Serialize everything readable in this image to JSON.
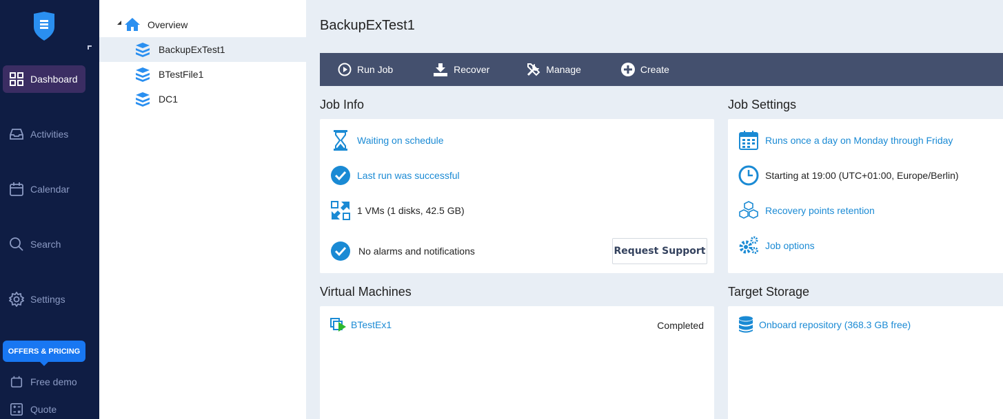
{
  "sidebar": {
    "items": [
      {
        "label": "Dashboard",
        "icon": "grid-icon"
      },
      {
        "label": "Activities",
        "icon": "inbox-icon"
      },
      {
        "label": "Calendar",
        "icon": "calendar-icon"
      },
      {
        "label": "Search",
        "icon": "search-icon"
      },
      {
        "label": "Settings",
        "icon": "gear-icon"
      }
    ],
    "offers_label": "OFFERS & PRICING",
    "free_demo": "Free demo",
    "quote": "Quote"
  },
  "tree": {
    "root": "Overview",
    "items": [
      "BackupExTest1",
      "BTestFile1",
      "DC1"
    ]
  },
  "main": {
    "title": "BackupExTest1",
    "toolbar": {
      "run_job": "Run Job",
      "recover": "Recover",
      "manage": "Manage",
      "create": "Create"
    },
    "job_info": {
      "title": "Job Info",
      "schedule_status": "Waiting on schedule",
      "last_run": "Last run was successful",
      "vms": "1 VMs (1 disks, 42.5 GB)",
      "alarms": "No alarms and notifications",
      "request_support": "Request Support"
    },
    "job_settings": {
      "title": "Job Settings",
      "schedule": "Runs once a day on Monday through Friday",
      "start": "Starting at 19:00 (UTC+01:00, Europe/Berlin)",
      "retention": "Recovery points retention",
      "options": "Job options"
    },
    "virtual_machines": {
      "title": "Virtual Machines",
      "rows": [
        {
          "name": "BTestEx1",
          "status": "Completed"
        }
      ]
    },
    "target_storage": {
      "title": "Target Storage",
      "repository": "Onboard repository (368.3 GB free)"
    }
  },
  "colors": {
    "sidebar_bg": "#0f1d44",
    "toolbar_bg": "#44506e",
    "accent": "#1a8ad4",
    "offers": "#1877f2"
  }
}
